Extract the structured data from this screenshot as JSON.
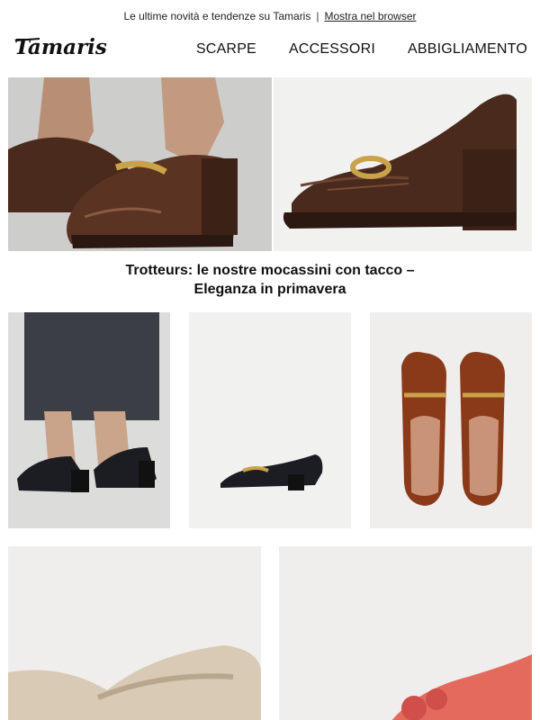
{
  "preheader": {
    "text": "Le ultime novità e tendenze su Tamaris",
    "separator": "|",
    "browser_link": "Mostra nel browser"
  },
  "header": {
    "logo_text": "Tamaris",
    "nav": [
      "SCARPE",
      "ACCESSORI",
      "ABBIGLIAMENTO"
    ]
  },
  "headline": {
    "line1": "Trotteurs: le nostre mocassini con tacco –",
    "line2": "Eleganza in primavera"
  },
  "colors": {
    "brown_patent": "#4a2a1c",
    "black_patent": "#1c1d22",
    "cognac": "#8a3a18",
    "beige": "#d8cab4",
    "coral": "#e46a5e",
    "gold": "#c9a24a"
  }
}
